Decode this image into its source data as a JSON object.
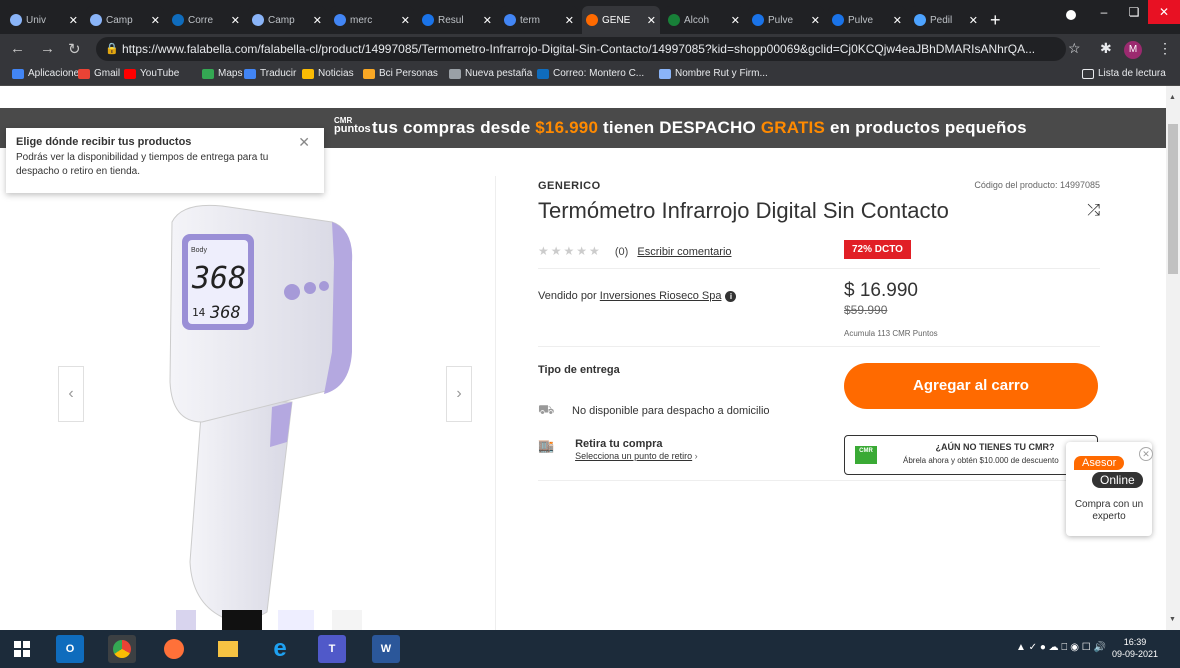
{
  "browser": {
    "tabs": [
      {
        "label": "Univ",
        "color": "#8ab4f8"
      },
      {
        "label": "Camp",
        "color": "#8ab4f8"
      },
      {
        "label": "Corre",
        "color": "#0f6cbd"
      },
      {
        "label": "Camp",
        "color": "#8ab4f8"
      },
      {
        "label": "merc",
        "color": "#4285f4"
      },
      {
        "label": "Resul",
        "color": "#1a73e8"
      },
      {
        "label": "term",
        "color": "#4285f4"
      },
      {
        "label": "GENE",
        "color": "#ff6a00"
      },
      {
        "label": "Alcoh",
        "color": "#188038"
      },
      {
        "label": "Pulve",
        "color": "#1a73e8"
      },
      {
        "label": "Pulve",
        "color": "#1a73e8"
      },
      {
        "label": "Pedil",
        "color": "#4da3ff"
      }
    ],
    "new_tab": "+",
    "url": "https://www.falabella.com/falabella-cl/product/14997085/Termometro-Infrarrojo-Digital-Sin-Contacto/14997085?kid=shopp00069&gclid=Cj0KCQjw4eaJBhDMARIsANhrQA...",
    "profile_initial": "M",
    "bookmarks": [
      {
        "label": "Aplicaciones",
        "color": "#4285f4"
      },
      {
        "label": "Gmail",
        "color": "#ea4335"
      },
      {
        "label": "YouTube",
        "color": "#ff0000"
      },
      {
        "label": "Maps",
        "color": "#34a853"
      },
      {
        "label": "Traducir",
        "color": "#4285f4"
      },
      {
        "label": "Noticias",
        "color": "#fbbc04"
      },
      {
        "label": "Bci Personas",
        "color": "#f9a825"
      },
      {
        "label": "Nueva pestaña",
        "color": "#9aa0a6"
      },
      {
        "label": "Correo: Montero C...",
        "color": "#0f6cbd"
      },
      {
        "label": "Nombre Rut y Firm...",
        "color": "#8ab4f8"
      }
    ],
    "reading_list": "Lista de lectura"
  },
  "page": {
    "promo": {
      "cmr_top": "CMR",
      "cmr_bottom": "puntos",
      "part1": "tus compras desde ",
      "amount": "$16.990",
      "part2": " tienen DESPACHO ",
      "gratis": "GRATIS",
      "part3": " en productos pequeños"
    },
    "popup": {
      "title": "Elige dónde recibir tus productos",
      "body": "Podrás ver la disponibilidad y tiempos de entrega para tu despacho o retiro en tienda."
    },
    "product": {
      "brand": "GENERICO",
      "code": "Código del producto: 14997085",
      "title": "Termómetro Infrarrojo Digital Sin Contacto",
      "stars": "★★★★★",
      "reviews": "(0)",
      "write_review": "Escribir comentario",
      "discount": "72% DCTO",
      "seller_prefix": "Vendido por ",
      "seller": "Inversiones Rioseco Spa",
      "price": "$ 16.990",
      "old_price": "$59.990",
      "cmr_points": "Acumula 113 CMR Puntos",
      "display_reading_1": "368",
      "display_reading_2": "368",
      "display_small": "14",
      "display_mode": "Body"
    },
    "delivery": {
      "title": "Tipo de entrega",
      "home": "No disponible para despacho a domicilio",
      "pickup_title": "Retira tu compra",
      "pickup_link": "Selecciona un punto de retiro"
    },
    "cart_button": "Agregar al carro",
    "cmr_card": {
      "logo": "CMR",
      "question": "¿AÚN NO TIENES TU CMR?",
      "desc": "Ábrela ahora y obtén $10.000 de descuento"
    },
    "asesor": {
      "tag1": "Asesor",
      "tag2": "Online",
      "text": "Compra con un experto"
    }
  },
  "taskbar": {
    "time": "16:39",
    "date": "09-09-2021"
  }
}
